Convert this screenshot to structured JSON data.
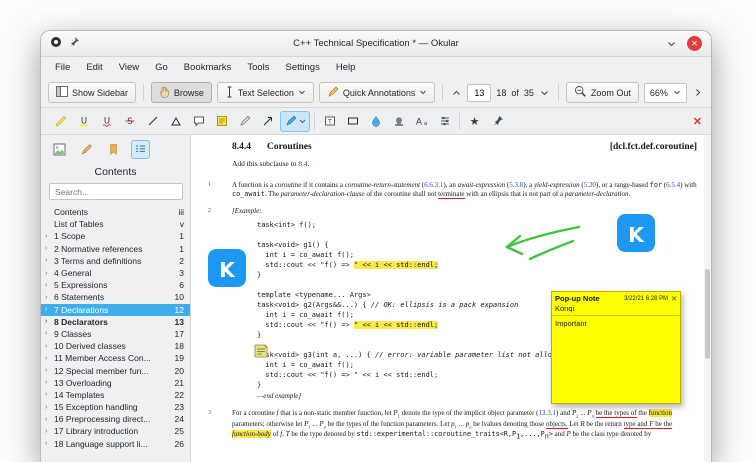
{
  "window": {
    "title": "C++ Technical Specification * — Okular"
  },
  "menubar": {
    "items": [
      "File",
      "Edit",
      "View",
      "Go",
      "Bookmarks",
      "Tools",
      "Settings",
      "Help"
    ]
  },
  "toolbar": {
    "show_sidebar": "Show Sidebar",
    "browse": "Browse",
    "text_selection": "Text Selection",
    "quick_annotations": "Quick Annotations",
    "page_current": "13",
    "page_position": "18",
    "of_label": "of",
    "page_total": "35",
    "zoom_out_label": "Zoom Out",
    "zoom_value": "66%"
  },
  "sidebar": {
    "title": "Contents",
    "search_placeholder": "Search...",
    "items": [
      {
        "label": "Contents",
        "page": "iii",
        "expandable": false
      },
      {
        "label": "List of Tables",
        "page": "v",
        "expandable": false
      },
      {
        "label": "1 Scope",
        "page": "1",
        "expandable": true
      },
      {
        "label": "2 Normative references",
        "page": "1",
        "expandable": true
      },
      {
        "label": "3 Terms and definitions",
        "page": "2",
        "expandable": true
      },
      {
        "label": "4 General",
        "page": "3",
        "expandable": true
      },
      {
        "label": "5 Expressions",
        "page": "6",
        "expandable": true
      },
      {
        "label": "6 Statements",
        "page": "10",
        "expandable": true
      },
      {
        "label": "7 Declarations",
        "page": "12",
        "expandable": true,
        "selected": true
      },
      {
        "label": "8 Declarators",
        "page": "13",
        "expandable": true,
        "bold": true
      },
      {
        "label": "9 Classes",
        "page": "17",
        "expandable": true
      },
      {
        "label": "10 Derived classes",
        "page": "18",
        "expandable": true
      },
      {
        "label": "11 Member Access Con...",
        "page": "19",
        "expandable": true
      },
      {
        "label": "12 Special member fun...",
        "page": "20",
        "expandable": true
      },
      {
        "label": "13 Overloading",
        "page": "21",
        "expandable": true
      },
      {
        "label": "14 Templates",
        "page": "22",
        "expandable": true
      },
      {
        "label": "15 Exception handling",
        "page": "23",
        "expandable": true
      },
      {
        "label": "16 Preprocessing direct...",
        "page": "24",
        "expandable": true
      },
      {
        "label": "17 Library introduction",
        "page": "25",
        "expandable": true
      },
      {
        "label": "18 Language support li...",
        "page": "26",
        "expandable": true
      }
    ]
  },
  "document": {
    "section_number": "8.4.4",
    "section_title": "Coroutines",
    "section_tag": "[dcl.fct.def.coroutine]",
    "paragraph_numbers": [
      "1",
      "2",
      "3"
    ],
    "stamp_letter": "K",
    "intro_runs": [
      {
        "t": "Add this subclause to "
      },
      {
        "t": "8.4",
        "c": "link"
      },
      {
        "t": "."
      }
    ],
    "example_open": "[Example:",
    "example_close": "—end example]",
    "para1_runs": [
      {
        "t": "A function is a "
      },
      {
        "t": "coroutine",
        "c": "i"
      },
      {
        "t": " if it contains a "
      },
      {
        "t": "coroutine-return-statement",
        "c": "i"
      },
      {
        "t": " ("
      },
      {
        "t": "6.6.3.1",
        "c": "link"
      },
      {
        "t": "), an "
      },
      {
        "t": "await-expression",
        "c": "i"
      },
      {
        "t": " ("
      },
      {
        "t": "5.3.8",
        "c": "link"
      },
      {
        "t": "), a "
      },
      {
        "t": "yield-expression",
        "c": "i"
      },
      {
        "t": " ("
      },
      {
        "t": "5.20",
        "c": "link"
      },
      {
        "t": "), or a range-based "
      },
      {
        "t": "for",
        "c": "code"
      },
      {
        "t": " ("
      },
      {
        "t": "6.5.4",
        "c": "link"
      },
      {
        "t": ") with "
      },
      {
        "t": "co_await",
        "c": "code"
      },
      {
        "t": ".  The "
      },
      {
        "t": "parameter-",
        "c": "i"
      },
      {
        "t": "declaration-clause",
        "c": "i"
      },
      {
        "t": " of the coroutine shall not "
      },
      {
        "t": "terminate",
        "c": "ulred"
      },
      {
        "t": " with an ellipsis that is not part of a "
      },
      {
        "t": "parameter-declaration",
        "c": "i"
      },
      {
        "t": "."
      }
    ],
    "code_lines": [
      [
        {
          "t": "task<int> f();"
        }
      ],
      [],
      [
        {
          "t": "task<void> g1() {"
        }
      ],
      [
        {
          "t": "  int i = co_await f();"
        }
      ],
      [
        {
          "t": "  std::cout << \"f() => "
        },
        {
          "t": "\" << i << std::endl;",
          "c": "hl"
        }
      ],
      [
        {
          "t": "}"
        }
      ],
      [],
      [
        {
          "t": "template <typename... Args>"
        }
      ],
      [
        {
          "t": "task<void> g2(Args&&...) { "
        },
        {
          "t": "// OK: ellipsis is a pack expansion",
          "c": "i"
        }
      ],
      [
        {
          "t": "  int i = co_await f();"
        }
      ],
      [
        {
          "t": "  std::cout << \"f() => "
        },
        {
          "t": "\" << i << std::endl;",
          "c": "hl"
        }
      ],
      [
        {
          "t": "}"
        }
      ],
      [],
      [
        {
          "t": "task<void> g3(int a, ...) { "
        },
        {
          "t": "// error: variable parameter list not allowed",
          "c": "i"
        }
      ],
      [
        {
          "t": "  int i = co_await f();"
        }
      ],
      [
        {
          "t": "  std::cout << \"f() => \" << i << std::endl;"
        }
      ],
      [
        {
          "t": "}"
        }
      ]
    ],
    "para3_runs": [
      {
        "t": "For a coroutine "
      },
      {
        "t": "f",
        "c": "i"
      },
      {
        "t": " that is a non-static member function, let "
      },
      {
        "t": "P",
        "c": "i"
      },
      {
        "t": "1",
        "c": "sub"
      },
      {
        "t": " denote the type of the implicit object parameter ("
      },
      {
        "t": "13.3.1",
        "c": "link"
      },
      {
        "t": ") and "
      },
      {
        "t": "P",
        "c": "i"
      },
      {
        "t": "2",
        "c": "sub"
      },
      {
        "t": " ... "
      },
      {
        "t": "P",
        "c": "i"
      },
      {
        "t": "n",
        "c": "sub i"
      },
      {
        "t": " "
      },
      {
        "t": "be the types of",
        "c": "ulred"
      },
      {
        "t": " the "
      },
      {
        "t": "function",
        "c": "hl"
      },
      {
        "t": " parameters; otherwise let "
      },
      {
        "t": "P",
        "c": "i"
      },
      {
        "t": "1",
        "c": "sub"
      },
      {
        "t": " ... "
      },
      {
        "t": "P",
        "c": "i"
      },
      {
        "t": "n",
        "c": "sub i"
      },
      {
        "t": " be the types of the function parameters.  Let "
      },
      {
        "t": "p",
        "c": "i"
      },
      {
        "t": "1",
        "c": "sub"
      },
      {
        "t": " ... "
      },
      {
        "t": "p",
        "c": "i"
      },
      {
        "t": "n",
        "c": "sub i"
      },
      {
        "t": " be lvalues denoting those "
      },
      {
        "t": "objects.",
        "c": "ulred"
      },
      {
        "t": "  Let "
      },
      {
        "t": "R",
        "c": "i"
      },
      {
        "t": " be the return "
      },
      {
        "t": "type and ",
        "c": "ulred"
      },
      {
        "t": "F",
        "c": "i ulred"
      },
      {
        "t": " be the ",
        "c": "ulred"
      },
      {
        "t": "function-body",
        "c": "i hl"
      },
      {
        "t": " of "
      },
      {
        "t": "f",
        "c": "i"
      },
      {
        "t": ", "
      },
      {
        "t": "T",
        "c": "i"
      },
      {
        "t": " be the type denoted by "
      },
      {
        "t": "std::experimental::coroutine_traits<R,P",
        "c": "code"
      },
      {
        "t": "1",
        "c": "sub code"
      },
      {
        "t": ",...,P",
        "c": "code"
      },
      {
        "t": "n",
        "c": "sub code"
      },
      {
        "t": ">",
        "c": "code"
      },
      {
        "t": " and "
      },
      {
        "t": "P",
        "c": "i"
      },
      {
        "t": " be the class type denoted by"
      }
    ]
  },
  "popup_note": {
    "title": "Pop-up Note",
    "timestamp": "3/22/21 6:28 PM",
    "author": "Konqi",
    "body": "Important"
  }
}
